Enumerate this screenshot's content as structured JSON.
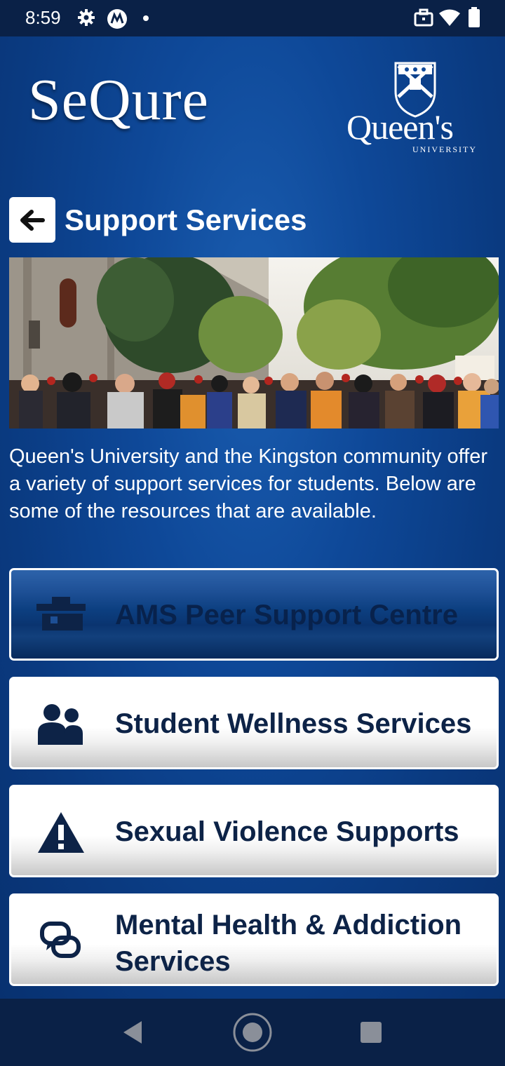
{
  "status_bar": {
    "time": "8:59",
    "icons": [
      "gear-icon",
      "motorola-icon",
      "dot-icon",
      "briefcase-icon",
      "wifi-icon",
      "battery-icon"
    ]
  },
  "header": {
    "app_logo_text": "SeQure",
    "university_logo_text": "Queen's",
    "university_logo_sub": "UNIVERSITY"
  },
  "page": {
    "title": "Support Services",
    "intro": "Queen's University and the Kingston community offer a variety of support services for students. Below are some of the resources that are available."
  },
  "services": [
    {
      "label": "AMS Peer Support Centre",
      "icon": "building-icon",
      "selected": true
    },
    {
      "label": "Student Wellness Services",
      "icon": "people-icon",
      "selected": false
    },
    {
      "label": "Sexual Violence Supports",
      "icon": "warning-icon",
      "selected": false
    },
    {
      "label": "Mental Health & Addiction Services",
      "icon": "chat-bubbles-icon",
      "selected": false
    }
  ],
  "colors": {
    "background": "#0e4898",
    "accent_text": "#0d2347",
    "system_bar": "#0a2147"
  }
}
